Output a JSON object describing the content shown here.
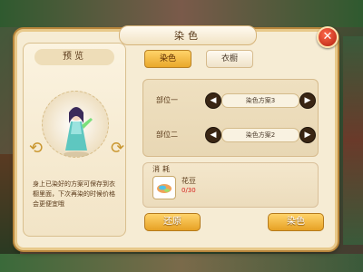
{
  "dialog": {
    "title": "染色",
    "close_label": "✕"
  },
  "preview": {
    "header": "预览",
    "note": "身上已染好的方案可保存到衣橱里面，下次再染的时候价格会更便宜哦"
  },
  "tabs": [
    {
      "label": "染色",
      "active": true
    },
    {
      "label": "衣橱",
      "active": false
    }
  ],
  "dye_parts": [
    {
      "label": "部位一",
      "scheme": "染色方案3"
    },
    {
      "label": "部位二",
      "scheme": "染色方案2"
    }
  ],
  "cost": {
    "header": "消耗",
    "item_name": "花豆",
    "item_count": "0/30"
  },
  "buttons": {
    "reset": "还原",
    "dye": "染色"
  },
  "colors": {
    "panel_bg": "#f6ecd4",
    "accent": "#e9a82b",
    "count_red": "#d6221e"
  }
}
